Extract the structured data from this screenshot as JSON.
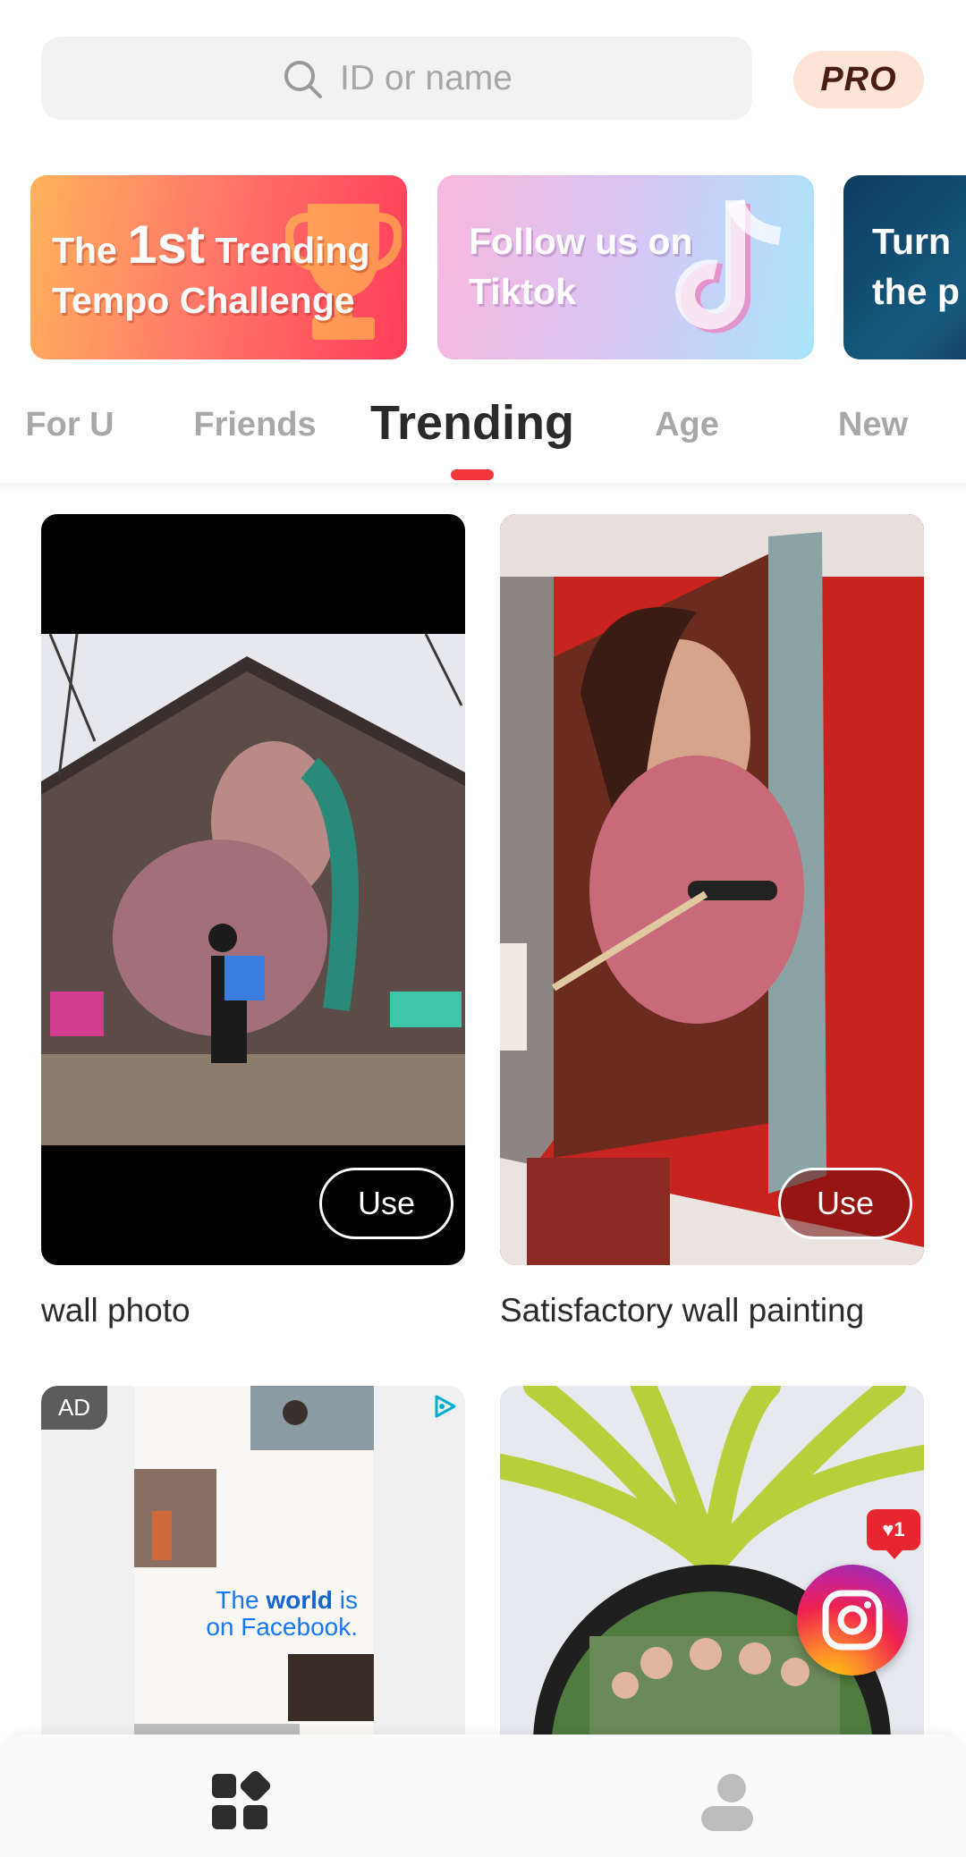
{
  "header": {
    "search_placeholder": "ID or name",
    "pro_label": "PRO"
  },
  "banners": [
    {
      "line1_pre": "The ",
      "line1_big": "1st",
      "line1_post": " Trending",
      "line2": "Tempo Challenge"
    },
    {
      "text": "Follow us on\nTiktok"
    },
    {
      "text": "Turn\nthe p"
    }
  ],
  "tabs": [
    {
      "label": "For U",
      "active": false
    },
    {
      "label": "Friends",
      "active": false
    },
    {
      "label": "Trending",
      "active": true
    },
    {
      "label": "Age",
      "active": false
    },
    {
      "label": "New",
      "active": false
    }
  ],
  "cards": [
    {
      "title": "wall photo",
      "button": "Use"
    },
    {
      "title": "Satisfactory wall painting",
      "button": "Use"
    }
  ],
  "ad": {
    "badge": "AD",
    "text_line1_pre": "The ",
    "text_line1_bold": "world",
    "text_line1_post": " is",
    "text_line2": "on Facebook."
  },
  "floating": {
    "like_count": "1"
  },
  "colors": {
    "accent": "#f2363a",
    "pro_bg": "#fde4d7",
    "pro_text": "#4a1d10"
  },
  "icons": {
    "search": "search-icon",
    "home": "grid-home-icon",
    "profile": "profile-icon",
    "instagram": "instagram-icon"
  }
}
